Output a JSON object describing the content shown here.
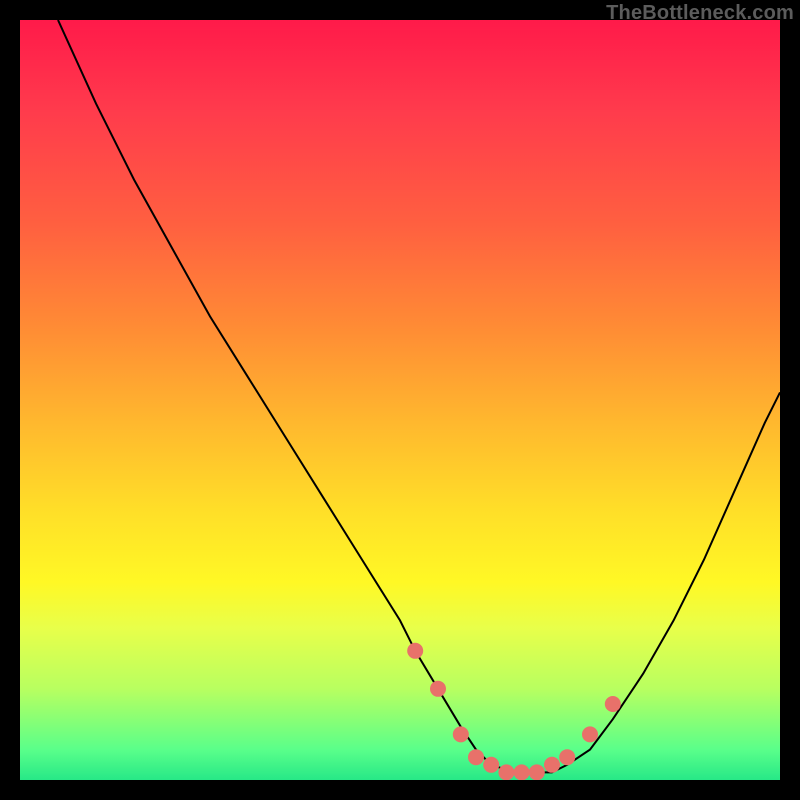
{
  "watermark": "TheBottleneck.com",
  "chart_data": {
    "type": "line",
    "title": "",
    "xlabel": "",
    "ylabel": "",
    "xlim": [
      0,
      100
    ],
    "ylim": [
      0,
      100
    ],
    "curve": {
      "name": "bottleneck-curve",
      "x": [
        5,
        10,
        15,
        20,
        25,
        30,
        35,
        40,
        45,
        50,
        52,
        55,
        58,
        60,
        62,
        65,
        68,
        70,
        72,
        75,
        78,
        82,
        86,
        90,
        94,
        98,
        100
      ],
      "y": [
        100,
        89,
        79,
        70,
        61,
        53,
        45,
        37,
        29,
        21,
        17,
        12,
        7,
        4,
        2,
        1,
        1,
        1,
        2,
        4,
        8,
        14,
        21,
        29,
        38,
        47,
        51
      ]
    },
    "dots": {
      "name": "highlight-points",
      "x": [
        52,
        55,
        58,
        60,
        62,
        64,
        66,
        68,
        70,
        72,
        75,
        78
      ],
      "y": [
        17,
        12,
        6,
        3,
        2,
        1,
        1,
        1,
        2,
        3,
        6,
        10
      ]
    }
  },
  "colors": {
    "dot": "#e8716a",
    "curve": "#000000"
  }
}
